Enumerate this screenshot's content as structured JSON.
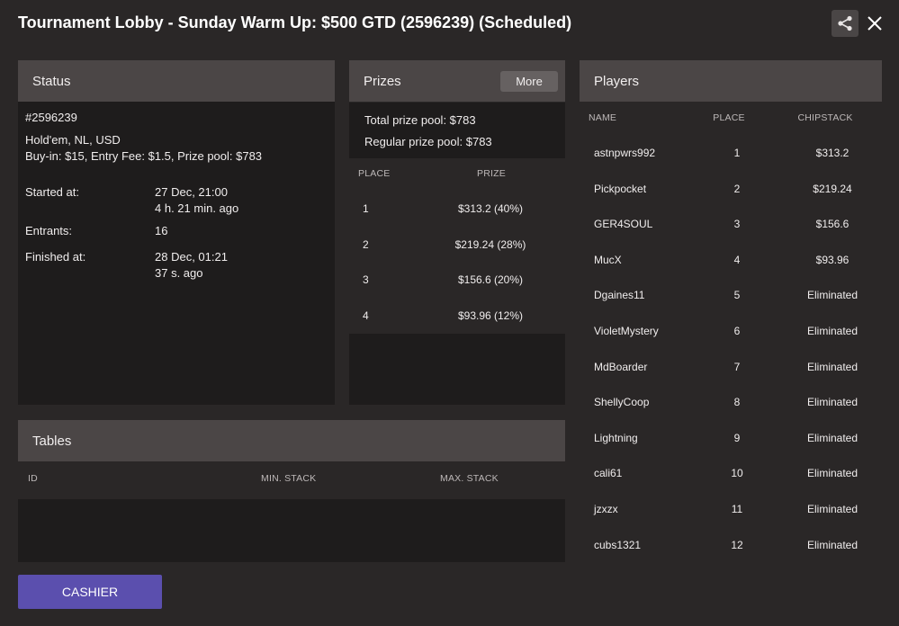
{
  "window": {
    "title": "Tournament Lobby - Sunday Warm Up: $500 GTD (2596239) (Scheduled)",
    "share_icon": "share-icon",
    "close_icon": "close-icon"
  },
  "status": {
    "heading": "Status",
    "tournament_id": "#2596239",
    "game": "Hold'em, NL, USD",
    "buyin_line": "Buy-in: $15, Entry Fee: $1.5, Prize pool: $783",
    "started_label": "Started at:",
    "started_value": "27 Dec, 21:00",
    "started_ago": "4 h. 21 min. ago",
    "entrants_label": "Entrants:",
    "entrants_value": "16",
    "finished_label": "Finished at:",
    "finished_value": "28 Dec, 01:21",
    "finished_ago": "37 s. ago"
  },
  "prizes": {
    "heading": "Prizes",
    "more_label": "More",
    "total_pool": "Total prize pool: $783",
    "regular_pool": "Regular prize pool: $783",
    "columns": [
      "PLACE",
      "PRIZE"
    ],
    "rows": [
      {
        "place": "1",
        "prize": "$313.2 (40%)"
      },
      {
        "place": "2",
        "prize": "$219.24 (28%)"
      },
      {
        "place": "3",
        "prize": "$156.6 (20%)"
      },
      {
        "place": "4",
        "prize": "$93.96 (12%)"
      }
    ]
  },
  "players": {
    "heading": "Players",
    "columns": [
      "NAME",
      "PLACE",
      "CHIPSTACK"
    ],
    "rows": [
      {
        "name": "astnpwrs992",
        "place": "1",
        "chips": "$313.2"
      },
      {
        "name": "Pickpocket",
        "place": "2",
        "chips": "$219.24"
      },
      {
        "name": "GER4SOUL",
        "place": "3",
        "chips": "$156.6"
      },
      {
        "name": "MucX",
        "place": "4",
        "chips": "$93.96"
      },
      {
        "name": "Dgaines11",
        "place": "5",
        "chips": "Eliminated"
      },
      {
        "name": "VioletMystery",
        "place": "6",
        "chips": "Eliminated"
      },
      {
        "name": "MdBoarder",
        "place": "7",
        "chips": "Eliminated"
      },
      {
        "name": "ShellyCoop",
        "place": "8",
        "chips": "Eliminated"
      },
      {
        "name": "Lightning",
        "place": "9",
        "chips": "Eliminated"
      },
      {
        "name": "cali61",
        "place": "10",
        "chips": "Eliminated"
      },
      {
        "name": "jzxzx",
        "place": "11",
        "chips": "Eliminated"
      },
      {
        "name": "cubs1321",
        "place": "12",
        "chips": "Eliminated"
      }
    ]
  },
  "tables": {
    "heading": "Tables",
    "columns": [
      "ID",
      "MIN. STACK",
      "MAX. STACK"
    ]
  },
  "cashier": {
    "label": "CASHIER"
  },
  "colors": {
    "background": "#2a2727",
    "panel_header": "#4b4646",
    "panel_body": "#1e1c1c",
    "cashier_button": "#5b4fae"
  }
}
